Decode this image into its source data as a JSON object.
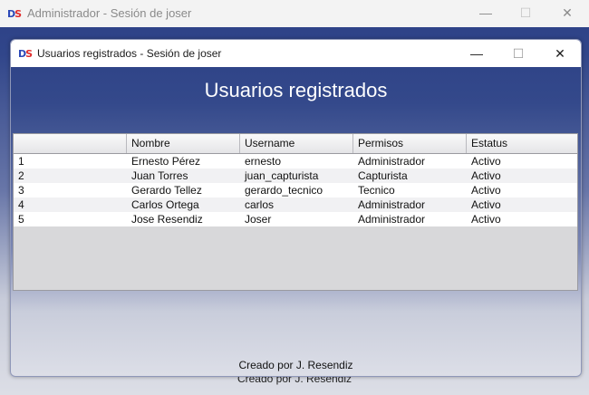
{
  "outer_window": {
    "logo": {
      "d": "D",
      "s": "S"
    },
    "title": "Administrador - Sesión de joser",
    "controls": {
      "minimize": "—",
      "maximize": "☐",
      "close": "✕"
    },
    "footer": "Creado por J. Resendiz"
  },
  "inner_window": {
    "logo": {
      "d": "D",
      "s": "S"
    },
    "title": "Usuarios registrados - Sesión de joser",
    "controls": {
      "minimize": "—",
      "maximize": "☐",
      "close": "✕"
    },
    "heading": "Usuarios registrados",
    "footer": "Creado por J. Resendiz"
  },
  "table": {
    "columns": [
      "",
      "Nombre",
      "Username",
      "Permisos",
      "Estatus"
    ],
    "rows": [
      [
        "1",
        "Ernesto Pérez",
        "ernesto",
        "Administrador",
        "Activo"
      ],
      [
        "2",
        "Juan Torres",
        "juan_capturista",
        "Capturista",
        "Activo"
      ],
      [
        "3",
        "Gerardo Tellez",
        "gerardo_tecnico",
        "Tecnico",
        "Activo"
      ],
      [
        "4",
        "Carlos Ortega",
        "carlos",
        "Administrador",
        "Activo"
      ],
      [
        "5",
        "Jose Resendiz",
        "Joser",
        "Administrador",
        "Activo"
      ]
    ]
  }
}
